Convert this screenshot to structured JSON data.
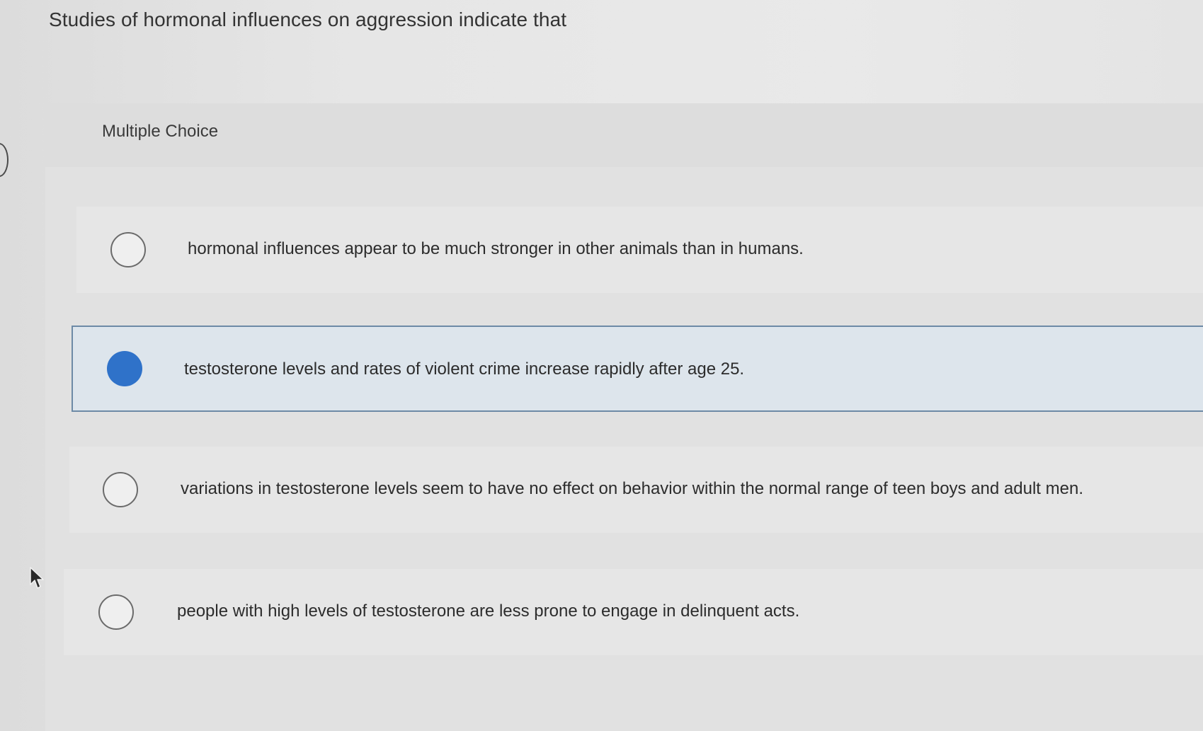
{
  "question": {
    "text": "Studies of hormonal influences on aggression indicate that"
  },
  "panel": {
    "label": "Multiple Choice"
  },
  "options": [
    {
      "text": "hormonal influences appear to be much stronger in other animals than in humans.",
      "selected": false
    },
    {
      "text": "testosterone levels and rates of violent crime increase rapidly after age 25.",
      "selected": true
    },
    {
      "text": "variations in testosterone levels seem to have no effect on behavior within the normal range of teen boys and adult men.",
      "selected": false
    },
    {
      "text": "people with high levels of testosterone are less prone to engage in delinquent acts.",
      "selected": false
    }
  ],
  "colors": {
    "selected_radio": "#2f72c9",
    "selected_border": "#6d8aa6",
    "selected_background": "#dde5ec"
  },
  "icons": {
    "cursor": "mouse-pointer-icon",
    "radio": "radio-button-icon"
  }
}
